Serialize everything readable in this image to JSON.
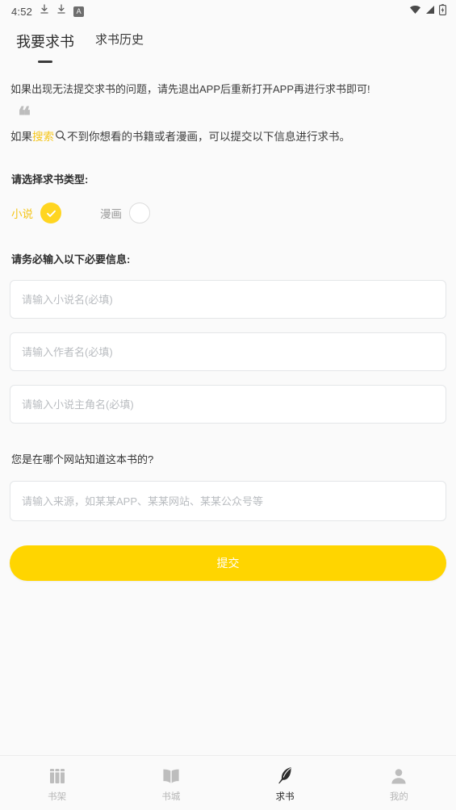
{
  "statusbar": {
    "time": "4:52",
    "icons_left": [
      "download-icon",
      "download-icon",
      "a-badge-icon"
    ],
    "a_badge_text": "A",
    "icons_right": [
      "wifi-icon",
      "cellular-signal-icon",
      "battery-charging-icon"
    ]
  },
  "tabs": [
    {
      "label": "我要求书",
      "active": true
    },
    {
      "label": "求书历史",
      "active": false
    }
  ],
  "main": {
    "notice": "如果出现无法提交求书的问题，请先退出APP后重新打开APP再进行求书即可!",
    "quote_icon": "quote-mark-icon",
    "quote": {
      "before": "如果",
      "highlight": "搜索",
      "search_icon": "search-icon",
      "after": "不到你想看的书籍或者漫画，可以提交以下信息进行求书。"
    },
    "type_label": "请选择求书类型:",
    "type_options": [
      {
        "label": "小说",
        "selected": true,
        "icon": "check-circle-icon"
      },
      {
        "label": "漫画",
        "selected": false,
        "icon": "empty-circle-icon"
      }
    ],
    "required_label": "请务必输入以下必要信息:",
    "fields": [
      {
        "name": "book-name",
        "value": "",
        "placeholder": "请输入小说名(必填)"
      },
      {
        "name": "author-name",
        "value": "",
        "placeholder": "请输入作者名(必填)"
      },
      {
        "name": "protagonist-name",
        "value": "",
        "placeholder": "请输入小说主角名(必填)"
      }
    ],
    "source_label": "您是在哪个网站知道这本书的?",
    "source_field": {
      "value": "",
      "placeholder": "请输入来源，如某某APP、某某网站、某某公众号等"
    },
    "submit_label": "提交"
  },
  "bottomnav": [
    {
      "label": "书架",
      "icon": "bookshelf-icon",
      "active": false
    },
    {
      "label": "书城",
      "icon": "open-book-icon",
      "active": false
    },
    {
      "label": "求书",
      "icon": "feather-quill-icon",
      "active": true
    },
    {
      "label": "我的",
      "icon": "person-icon",
      "active": false
    }
  ],
  "colors": {
    "accent_yellow": "#ffd500",
    "radio_yellow": "#ffd520",
    "highlight_yellow": "#f5c518",
    "page_bg": "#fafafa",
    "text_primary": "#2e2e2e",
    "text_muted": "#b6b6b6",
    "field_border": "#e4e6e8"
  }
}
